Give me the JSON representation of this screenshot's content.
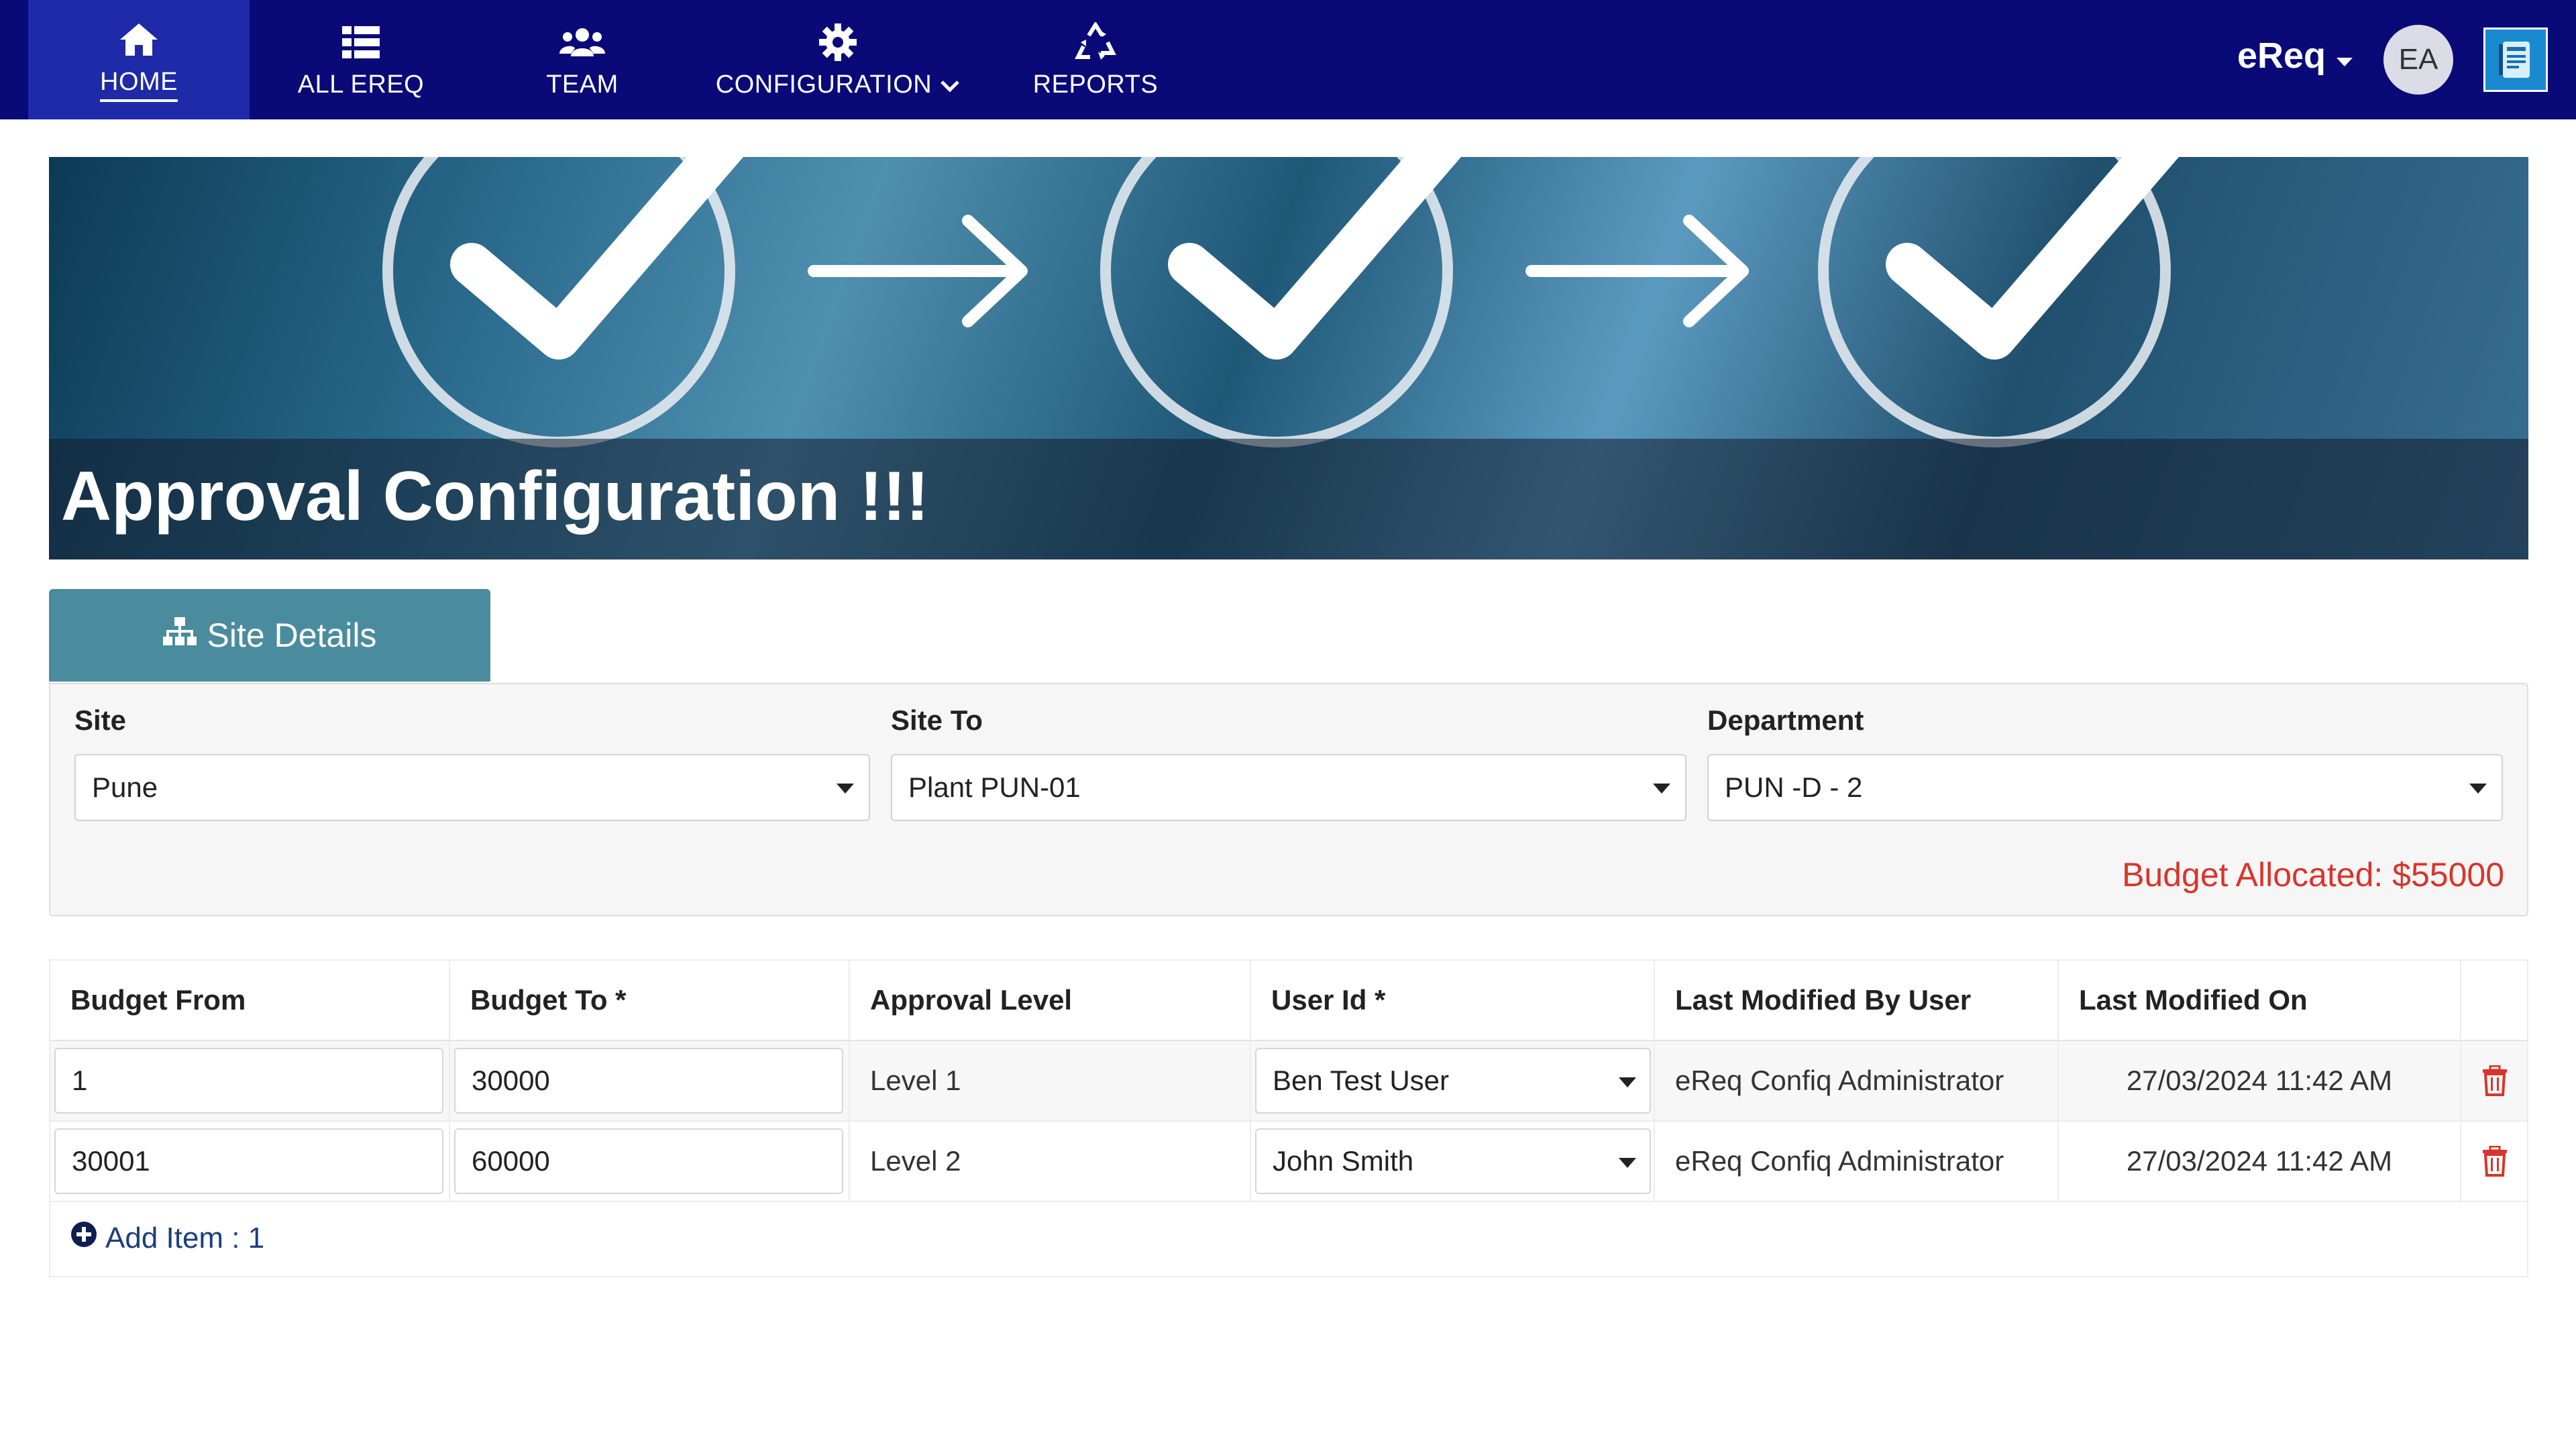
{
  "nav": {
    "items": [
      {
        "label": "HOME",
        "icon": "home-icon"
      },
      {
        "label": "ALL EREQ",
        "icon": "list-icon"
      },
      {
        "label": "TEAM",
        "icon": "users-icon"
      },
      {
        "label": "CONFIGURATION",
        "icon": "gear-icon"
      },
      {
        "label": "REPORTS",
        "icon": "recycle-icon"
      }
    ],
    "active": "HOME",
    "brand": "eReq",
    "avatar_initials": "EA"
  },
  "banner": {
    "title": "Approval Configuration !!!"
  },
  "tab": {
    "label": "Site Details",
    "icon": "sitemap-icon"
  },
  "form": {
    "site": {
      "label": "Site",
      "value": "Pune"
    },
    "site_to": {
      "label": "Site To",
      "value": "Plant PUN-01"
    },
    "department": {
      "label": "Department",
      "value": "PUN -D - 2"
    },
    "budget_allocated": "Budget Allocated: $55000"
  },
  "table": {
    "headers": [
      "Budget From",
      "Budget To *",
      "Approval Level",
      "User Id *",
      "Last Modified By User",
      "Last Modified On"
    ],
    "rows": [
      {
        "budget_from": "1",
        "budget_to": "30000",
        "approval_level": "Level 1",
        "user_id": "Ben Test User",
        "modified_by": "eReq Confiq Administrator",
        "modified_on": "27/03/2024 11:42 AM"
      },
      {
        "budget_from": "30001",
        "budget_to": "60000",
        "approval_level": "Level 2",
        "user_id": "John Smith",
        "modified_by": "eReq Confiq Administrator",
        "modified_on": "27/03/2024 11:42 AM"
      }
    ],
    "add_item_label": "Add Item : 1"
  },
  "colors": {
    "navbar": "#090a78",
    "tab": "#4a8c9d",
    "budget_text": "#d9342b",
    "delete_icon": "#d9342b"
  }
}
